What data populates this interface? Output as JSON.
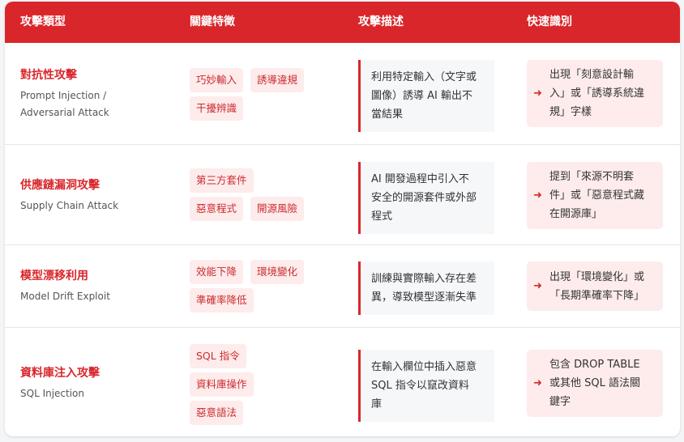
{
  "header": {
    "col1": "攻擊類型",
    "col2": "關鍵特徵",
    "col3": "攻擊描述",
    "col4": "快速識別"
  },
  "rows": [
    {
      "name_zh": "對抗性攻擊",
      "name_en_1": "Prompt Injection /",
      "name_en_2": "Adversarial Attack",
      "tags": [
        "巧妙輸入",
        "誘導違規",
        "干擾辨識"
      ],
      "desc_lines": [
        "利用特定輸入（文字或",
        "圖像）誘導 AI 輸出不",
        "當結果"
      ],
      "quick_lines": [
        "出現「刻意設計輸",
        "入」或「誘導系統違",
        "規」字樣"
      ]
    },
    {
      "name_zh": "供應鏈漏洞攻擊",
      "name_en_1": "Supply Chain Attack",
      "tags": [
        "第三方套件",
        "惡意程式",
        "開源風險"
      ],
      "desc_lines": [
        "AI 開發過程中引入不",
        "安全的開源套件或外部",
        "程式"
      ],
      "quick_lines": [
        "提到「來源不明套",
        "件」或「惡意程式藏",
        "在開源庫」"
      ]
    },
    {
      "name_zh": "模型漂移利用",
      "name_en_1": "Model Drift Exploit",
      "tags": [
        "效能下降",
        "環境變化",
        "準確率降低"
      ],
      "desc_lines": [
        "訓練與實際輸入存在差",
        "異，導致模型逐漸失準"
      ],
      "quick_lines": [
        "出現「環境變化」或",
        "「長期準確率下降」"
      ]
    },
    {
      "name_zh": "資料庫注入攻擊",
      "name_en_1": "SQL Injection",
      "tags": [
        "SQL 指令",
        "資料庫操作",
        "惡意語法"
      ],
      "desc_lines": [
        "在輸入欄位中插入惡意",
        "SQL 指令以竄改資料",
        "庫"
      ],
      "quick_lines": [
        "包含 DROP TABLE",
        "或其他 SQL 語法關",
        "鍵字"
      ]
    }
  ],
  "icons": {
    "quick_arrow": "arrow-right-icon"
  },
  "colors": {
    "accent": "#d9262b",
    "tag_bg": "#fdeceb"
  }
}
